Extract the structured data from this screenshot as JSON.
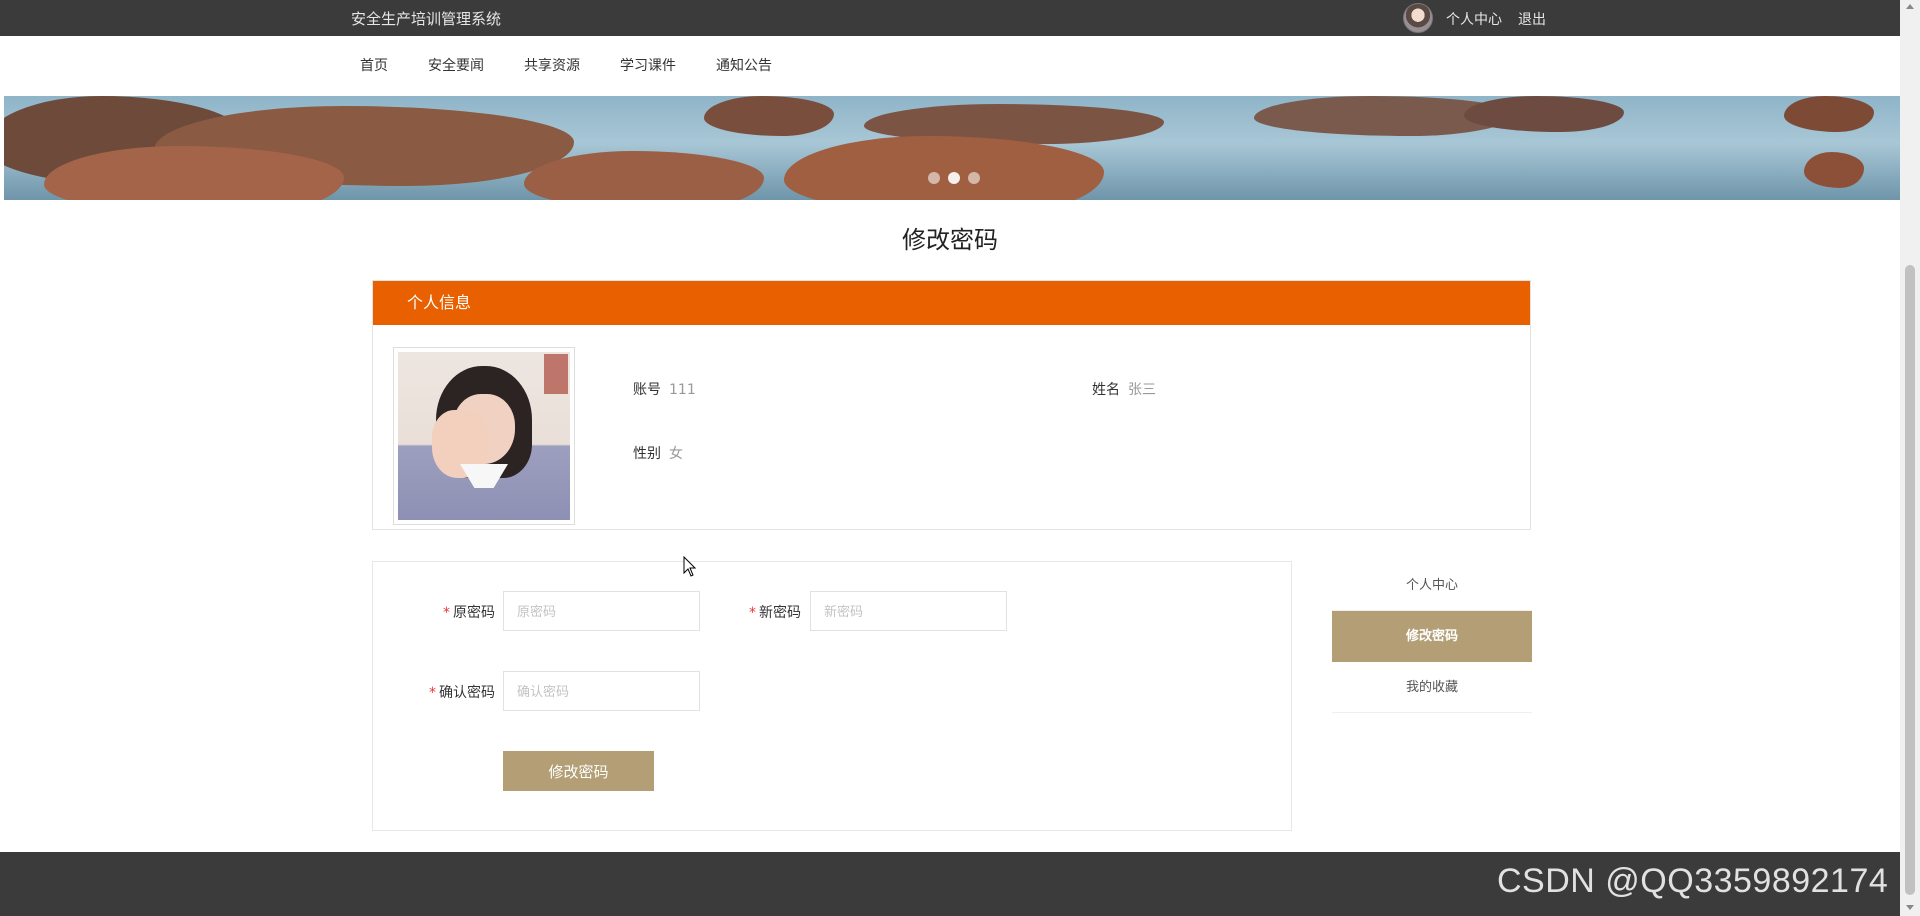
{
  "header": {
    "site_title": "安全生产培训管理系统",
    "personal_center": "个人中心",
    "logout": "退出"
  },
  "nav": {
    "items": [
      {
        "label": "首页"
      },
      {
        "label": "安全要闻"
      },
      {
        "label": "共享资源"
      },
      {
        "label": "学习课件"
      },
      {
        "label": "通知公告"
      }
    ]
  },
  "banner": {
    "slide_count": 3,
    "active_slide": 2
  },
  "page": {
    "title": "修改密码"
  },
  "profile": {
    "section_title": "个人信息",
    "account_label": "账号",
    "account_value": "111",
    "name_label": "姓名",
    "name_value": "张三",
    "gender_label": "性别",
    "gender_value": "女"
  },
  "form": {
    "required_mark": "*",
    "old_password_label": "原密码",
    "old_password_placeholder": "原密码",
    "new_password_label": "新密码",
    "new_password_placeholder": "新密码",
    "confirm_password_label": "确认密码",
    "confirm_password_placeholder": "确认密码",
    "submit_label": "修改密码"
  },
  "side_menu": {
    "items": [
      {
        "label": "个人中心",
        "active": false
      },
      {
        "label": "修改密码",
        "active": true
      },
      {
        "label": "我的收藏",
        "active": false
      }
    ]
  },
  "watermark": "CSDN @QQ3359892174",
  "colors": {
    "topbar": "#3b3b3b",
    "header_orange": "#e86000",
    "accent_tan": "#b39e75",
    "required_red": "#e4393c"
  }
}
